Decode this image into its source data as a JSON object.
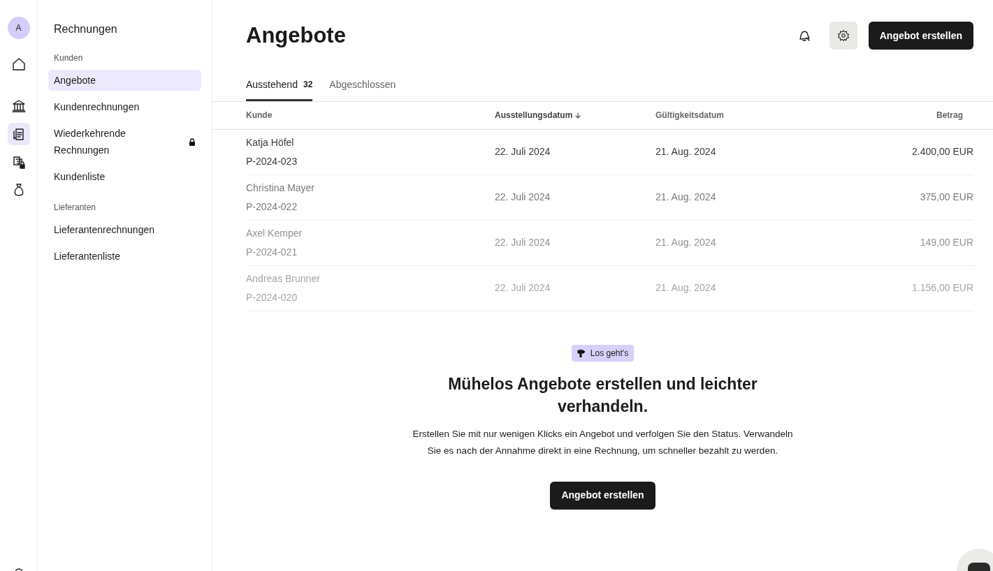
{
  "rail": {
    "avatar": "A",
    "items": [
      {
        "kind": "home",
        "selected": false
      },
      {
        "kind": "bank",
        "selected": false
      },
      {
        "kind": "invoices",
        "selected": true
      },
      {
        "kind": "locked-docs",
        "selected": false
      },
      {
        "kind": "money-bag",
        "selected": false
      }
    ]
  },
  "sidebar": {
    "title": "Rechnungen",
    "sections": [
      {
        "heading": "Kunden",
        "items": [
          {
            "label": "Angebote",
            "selected": true,
            "locked": false
          },
          {
            "label": "Kundenrechnungen",
            "selected": false,
            "locked": false
          },
          {
            "label": "Wiederkehrende Rechnungen",
            "selected": false,
            "locked": true
          },
          {
            "label": "Kundenliste",
            "selected": false,
            "locked": false
          }
        ]
      },
      {
        "heading": "Lieferanten",
        "items": [
          {
            "label": "Lieferantenrechnungen",
            "selected": false,
            "locked": false
          },
          {
            "label": "Lieferantenliste",
            "selected": false,
            "locked": false
          }
        ]
      }
    ]
  },
  "page": {
    "title": "Angebote",
    "primary_button": "Angebot erstellen"
  },
  "tabs": [
    {
      "label": "Ausstehend",
      "count": "32",
      "selected": true
    },
    {
      "label": "Abgeschlossen",
      "selected": false
    }
  ],
  "table": {
    "columns": [
      {
        "label": "Kunde",
        "sorted": false
      },
      {
        "label": "Ausstellungsdatum",
        "sorted": true
      },
      {
        "label": "Gültigkeitsdatum",
        "sorted": false
      },
      {
        "label": "Betrag",
        "sorted": false
      }
    ],
    "rows": [
      {
        "customer": "Katja Höfel",
        "number": "P-2024-023",
        "issued": "22. Juli 2024",
        "valid": "21. Aug. 2024",
        "amount": "2.400,00 EUR"
      },
      {
        "customer": "Christina Mayer",
        "number": "P-2024-022",
        "issued": "22. Juli 2024",
        "valid": "21. Aug. 2024",
        "amount": "375,00 EUR"
      },
      {
        "customer": "Axel Kemper",
        "number": "P-2024-021",
        "issued": "22. Juli 2024",
        "valid": "21. Aug. 2024",
        "amount": "149,00 EUR"
      },
      {
        "customer": "Andreas Brunner",
        "number": "P-2024-020",
        "issued": "22. Juli 2024",
        "valid": "21. Aug. 2024",
        "amount": "1.156,00 EUR"
      }
    ]
  },
  "empty_state": {
    "badge": "Los geht's",
    "heading": "Mühelos Angebote erstellen und leichter verhandeln.",
    "text": "Erstellen Sie mit nur wenigen Klicks ein Angebot und verfolgen Sie den Status. Verwandeln Sie es nach der Annahme direkt in eine Rechnung, um schneller bezahlt zu werden.",
    "button": "Angebot erstellen"
  }
}
